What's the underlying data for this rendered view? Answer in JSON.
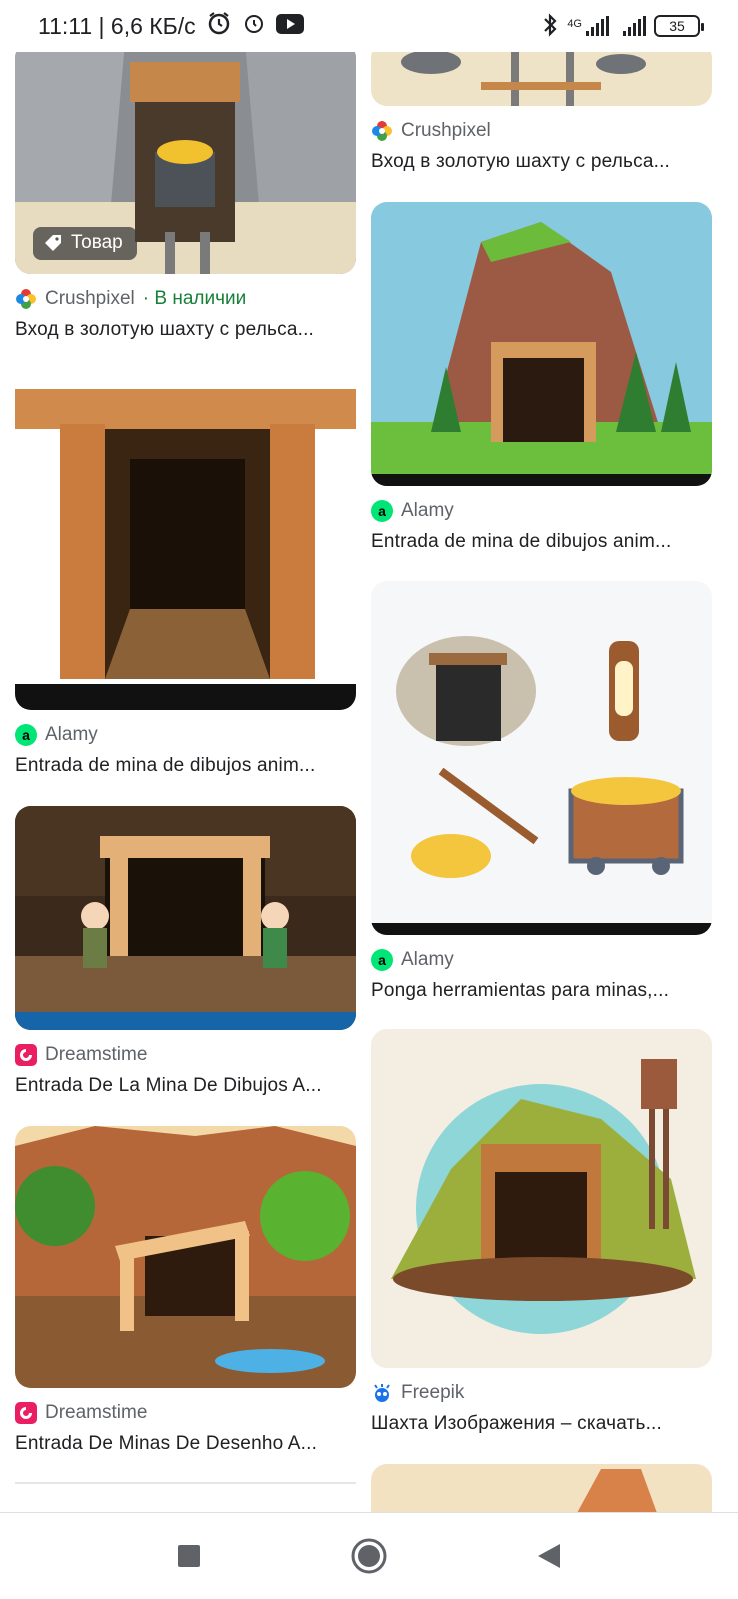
{
  "status_bar": {
    "left_text": "11:11 | 6,6 КБ/с",
    "network": "4G",
    "battery": "35"
  },
  "results": {
    "left": [
      {
        "source": "Crushpixel",
        "stock": "· В наличии",
        "title": "Вход в золотую шахту с рельса...",
        "tag": "Товар"
      },
      {
        "source": "Alamy",
        "title": "Entrada de mina de dibujos anim..."
      },
      {
        "source": "Dreamstime",
        "title": "Entrada De La Mina De Dibujos A..."
      },
      {
        "source": "Dreamstime",
        "title": "Entrada De Minas De Desenho A..."
      }
    ],
    "right": [
      {
        "source": "Crushpixel",
        "title": "Вход в золотую шахту с рельса..."
      },
      {
        "source": "Alamy",
        "title": "Entrada de mina de dibujos anim..."
      },
      {
        "source": "Alamy",
        "title": "Ponga herramientas para minas,..."
      },
      {
        "source": "Freepik",
        "title": "Шахта Изображения – скачать..."
      }
    ]
  },
  "colors": {
    "alamy": "#00e676",
    "dreamstime": "#e91e63",
    "freepik": "#1a73e8",
    "stock_green": "#188038"
  }
}
